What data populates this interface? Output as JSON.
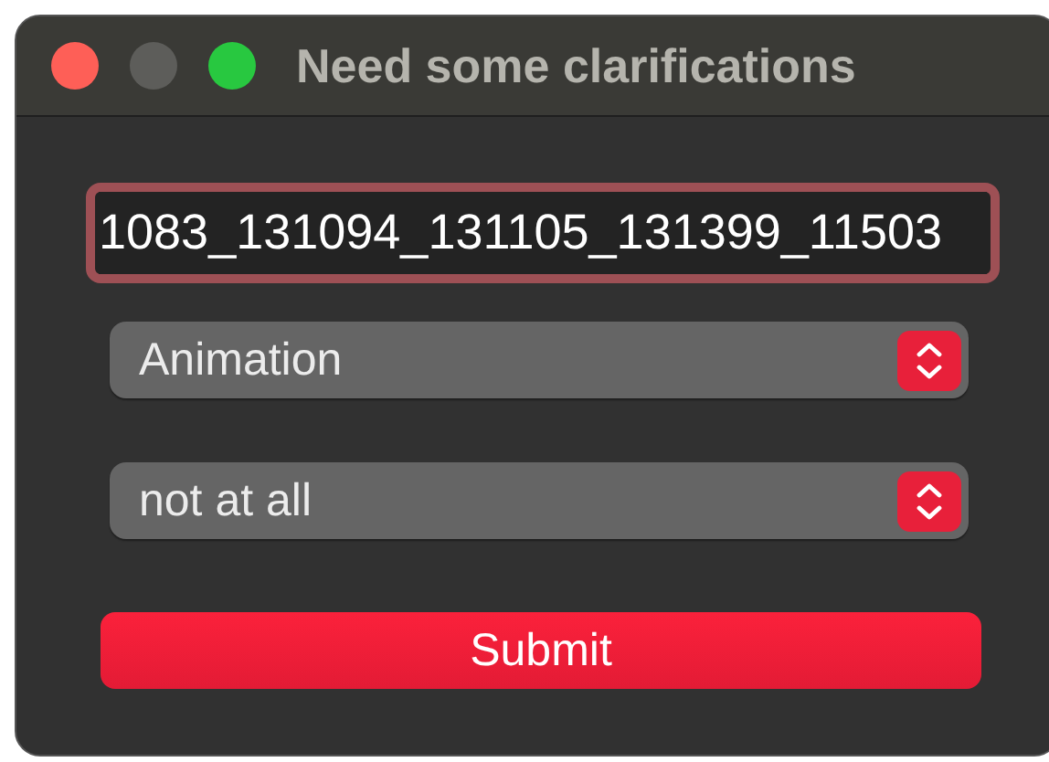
{
  "window": {
    "title": "Need some clarifications"
  },
  "text_field": {
    "value": "1083_131094_131105_131399_11503",
    "focused": true
  },
  "selects": [
    {
      "value": "Animation"
    },
    {
      "value": "not at all"
    }
  ],
  "buttons": [
    "Submit"
  ]
}
